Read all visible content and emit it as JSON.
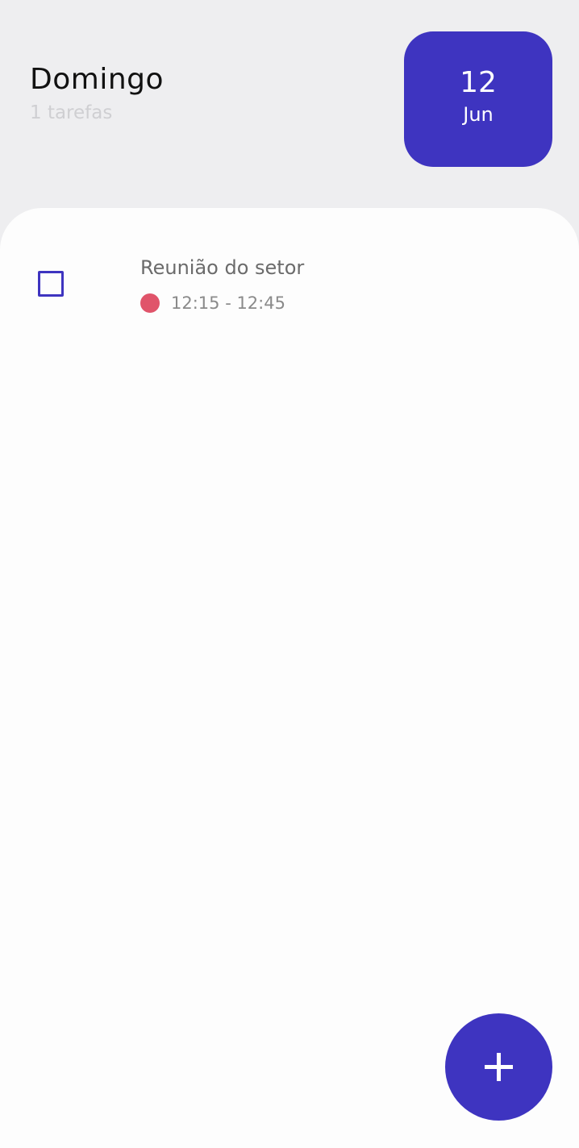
{
  "header": {
    "day_name": "Domingo",
    "task_count": "1 tarefas"
  },
  "date_badge": {
    "day": "12",
    "month": "Jun"
  },
  "tasks": [
    {
      "title": "Reunião do setor",
      "time": "12:15 - 12:45",
      "priority_color": "#e0546a"
    }
  ],
  "fab": {
    "icon": "plus-icon"
  },
  "colors": {
    "accent": "#3e34c0",
    "background": "#eeeef0",
    "sheet": "#fdfdfd"
  }
}
